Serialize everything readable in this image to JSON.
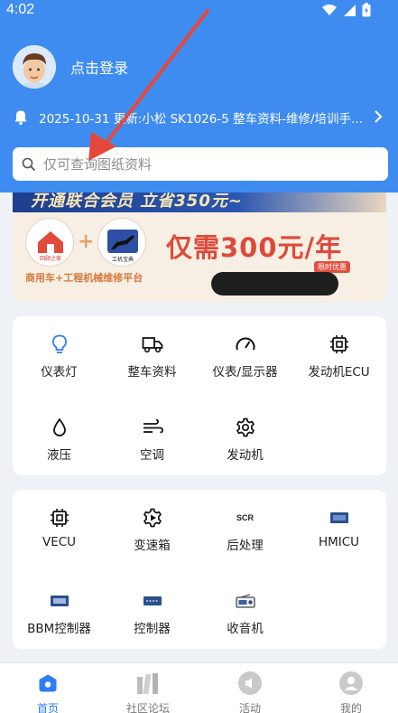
{
  "status_bar": {
    "time": "4:02"
  },
  "profile": {
    "login_text": "点击登录"
  },
  "notice": {
    "text": "2025-10-31 更新:小松 SK1026-5 整车资料-维修/培训手..."
  },
  "search": {
    "placeholder": "仅可查询图纸资料"
  },
  "banner": {
    "top_text": "开通联合会员 立省350元~",
    "logo1_text": "回顾之家",
    "logo2_text": "工机宝典",
    "subtitle": "商用车+工程机械维修平台",
    "price_text": "仅需300元/年",
    "tag": "限时优惠"
  },
  "grid1": [
    {
      "label": "仪表灯",
      "icon": "bulb-icon"
    },
    {
      "label": "整车资料",
      "icon": "truck-icon"
    },
    {
      "label": "仪表/显示器",
      "icon": "gauge-icon"
    },
    {
      "label": "发动机ECU",
      "icon": "chip-icon"
    },
    {
      "label": "液压",
      "icon": "droplet-icon"
    },
    {
      "label": "空调",
      "icon": "wind-icon"
    },
    {
      "label": "发动机",
      "icon": "gear-icon"
    }
  ],
  "grid2": [
    {
      "label": "VECU",
      "icon": "chip-icon"
    },
    {
      "label": "变速箱",
      "icon": "gearbox-icon"
    },
    {
      "label": "后处理",
      "icon": "scr-icon",
      "icon_text": "SCR"
    },
    {
      "label": "HMICU",
      "icon": "module-icon"
    },
    {
      "label": "BBM控制器",
      "icon": "bbm-module-icon"
    },
    {
      "label": "控制器",
      "icon": "controller-module-icon"
    },
    {
      "label": "收音机",
      "icon": "radio-icon"
    }
  ],
  "tabs": [
    {
      "label": "首页",
      "icon": "home-icon",
      "active": true
    },
    {
      "label": "社区论坛",
      "icon": "books-icon",
      "active": false
    },
    {
      "label": "活动",
      "icon": "speaker-icon",
      "active": false
    },
    {
      "label": "我的",
      "icon": "user-icon",
      "active": false
    }
  ],
  "colors": {
    "header": "#3f8cf0",
    "active": "#2f7df0",
    "accent_red": "#dd4a3b"
  }
}
